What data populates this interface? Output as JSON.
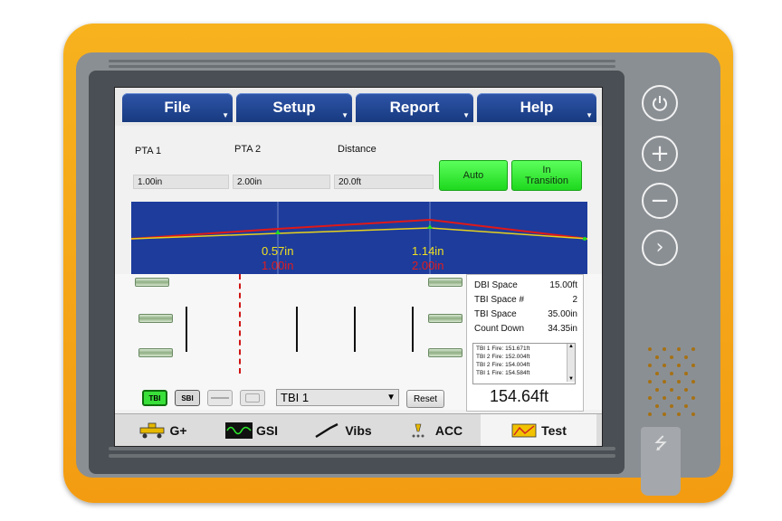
{
  "menu": {
    "file": "File",
    "setup": "Setup",
    "report": "Report",
    "help": "Help"
  },
  "pta": {
    "pta1_label": "PTA 1",
    "pta1_value": "1.00in",
    "pta2_label": "PTA 2",
    "pta2_value": "2.00in",
    "distance_label": "Distance",
    "distance_value": "20.0ft",
    "auto_button": "Auto",
    "transition_line1": "In",
    "transition_line2": "Transition"
  },
  "plot": {
    "marker1_measured": "0.57in",
    "marker1_target": "1.00in",
    "marker2_measured": "1.14in",
    "marker2_target": "2.00in"
  },
  "info": {
    "rows": [
      {
        "label": "DBI Space",
        "value": "15.00ft"
      },
      {
        "label": "TBI Space #",
        "value": "2"
      },
      {
        "label": "TBI Space",
        "value": "35.00in"
      },
      {
        "label": "Count Down",
        "value": "34.35in"
      }
    ],
    "log": [
      {
        "label": "TBI 1 Fire:",
        "value": "151.671ft"
      },
      {
        "label": "TBI 2 Fire:",
        "value": "152.004ft"
      },
      {
        "label": "TBI 2 Fire:",
        "value": "154.004ft"
      },
      {
        "label": "TBI 1 Fire:",
        "value": "154.584ft"
      }
    ]
  },
  "controls": {
    "tbi_mode": "TBI",
    "sbi_mode": "SBI",
    "selected_tbi": "TBI 1",
    "reset": "Reset",
    "distance": "154.64ft"
  },
  "tabs": {
    "g_plus": "G+",
    "gsi": "GSI",
    "vibs": "Vibs",
    "acc": "ACC",
    "test": "Test"
  },
  "colors": {
    "menu_blue": "#1f4594",
    "plot_blue": "#1d3c9c",
    "accent_green": "#2ee82e",
    "shell_orange": "#f5a418"
  }
}
